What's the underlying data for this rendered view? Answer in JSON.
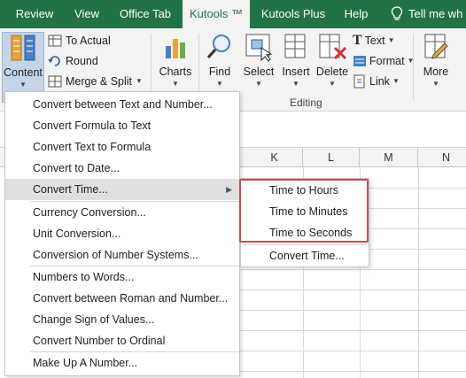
{
  "tabs": [
    {
      "label": "Review",
      "active": false
    },
    {
      "label": "View",
      "active": false
    },
    {
      "label": "Office Tab",
      "active": false
    },
    {
      "label": "Kutools ™",
      "active": true
    },
    {
      "label": "Kutools Plus",
      "active": false
    },
    {
      "label": "Help",
      "active": false
    }
  ],
  "tell_me": "Tell me wh",
  "ribbon": {
    "content_label": "Content",
    "to_actual_label": "To Actual",
    "round_label": "Round",
    "merge_split_label": "Merge & Split",
    "charts_label": "Charts",
    "find_label": "Find",
    "select_label": "Select",
    "insert_label": "Insert",
    "delete_label": "Delete",
    "text_label": "Text",
    "format_label": "Format",
    "link_label": "Link",
    "more_label": "More",
    "editing_group_label": "Editing"
  },
  "columns": [
    "K",
    "L",
    "M",
    "N"
  ],
  "menu": {
    "items": [
      "Convert between Text and Number...",
      "Convert Formula to Text",
      "Convert Text to Formula",
      "Convert to Date...",
      "Convert Time...",
      "Currency Conversion...",
      "Unit Conversion...",
      "Conversion of Number Systems...",
      "Numbers to Words...",
      "Convert between Roman and Number...",
      "Change Sign of Values...",
      "Convert Number to Ordinal",
      "Make Up A Number..."
    ],
    "highlighted": "Convert Time..."
  },
  "submenu": {
    "items": [
      "Time to Hours",
      "Time to Minutes",
      "Time to Seconds",
      "Convert Time..."
    ]
  },
  "colors": {
    "ribbon_green": "#217346",
    "highlight_box": "#c0504d"
  }
}
